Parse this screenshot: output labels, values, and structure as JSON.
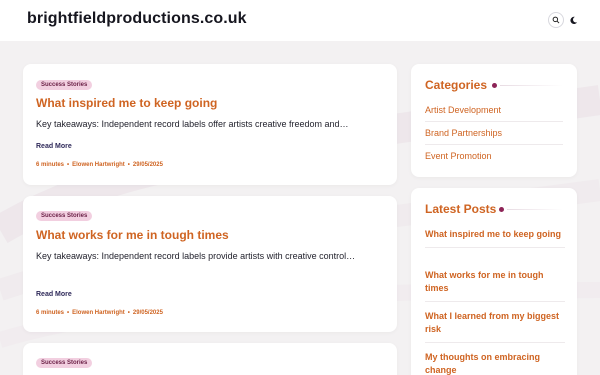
{
  "site": {
    "title": "brightfieldproductions.co.uk"
  },
  "header": {
    "search_icon": "search-icon",
    "theme_icon": "moon-icon"
  },
  "posts": [
    {
      "tag": "Success Stories",
      "title": "What inspired me to keep going",
      "excerpt": "Key takeaways: Independent record labels offer artists creative freedom and…",
      "read_more": "Read More",
      "read_time": "6 minutes",
      "author": "Elowen Hartwright",
      "date": "29/05/2025"
    },
    {
      "tag": "Success Stories",
      "title": "What works for me in tough times",
      "excerpt": "Key takeaways: Independent record labels provide artists with creative control…",
      "read_more": "Read More",
      "read_time": "6 minutes",
      "author": "Elowen Hartwright",
      "date": "29/05/2025"
    },
    {
      "tag": "Success Stories"
    }
  ],
  "sidebar": {
    "categories": {
      "heading": "Categories",
      "items": [
        "Artist Development",
        "Brand Partnerships",
        "Event Promotion"
      ]
    },
    "latest": {
      "heading": "Latest Posts",
      "items": [
        "What inspired me to keep going",
        "What works for me in tough times",
        "What I learned from my biggest risk",
        "My thoughts on embracing change"
      ]
    }
  },
  "colors": {
    "accent": "#cf6422",
    "tag_bg": "#f2cfe0",
    "dot": "#8d2457"
  }
}
